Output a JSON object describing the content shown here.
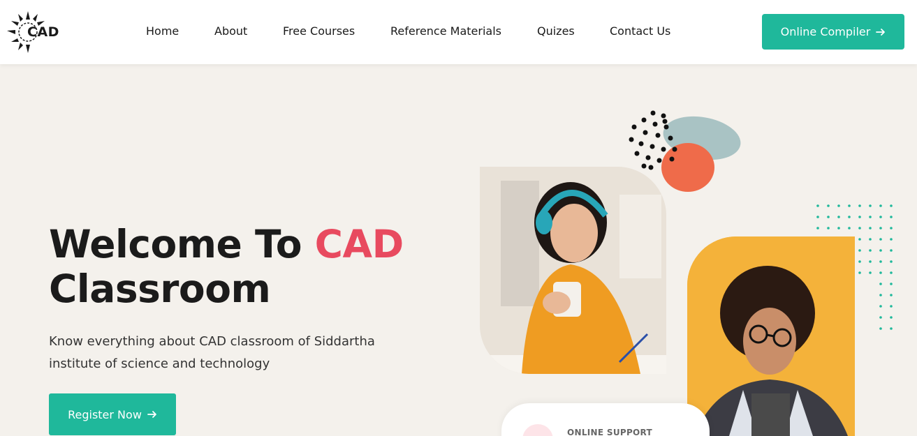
{
  "header": {
    "logo_text": "CAD",
    "nav": [
      {
        "label": "Home"
      },
      {
        "label": "About"
      },
      {
        "label": "Free Courses"
      },
      {
        "label": "Reference Materials"
      },
      {
        "label": "Quizes"
      },
      {
        "label": "Contact Us"
      }
    ],
    "cta_label": "Online Compiler"
  },
  "hero": {
    "title_part1": "Welcome To ",
    "title_accent": "CAD",
    "title_part2": "Classroom",
    "description": "Know everything about CAD classroom of Siddartha institute of science and technology",
    "register_label": "Register Now"
  },
  "support": {
    "label": "ONLINE SUPPORT"
  },
  "colors": {
    "accent": "#1fb89b",
    "title_accent": "#e84a5f",
    "background": "#f4f1ec",
    "orange": "#f4b23a",
    "coral": "#ef6b4a",
    "sage": "#a9c3c4"
  },
  "icons": {
    "logo": "sun-logo-icon",
    "cta_arrow": "arrow-right-icon",
    "register_arrow": "arrow-right-icon"
  }
}
